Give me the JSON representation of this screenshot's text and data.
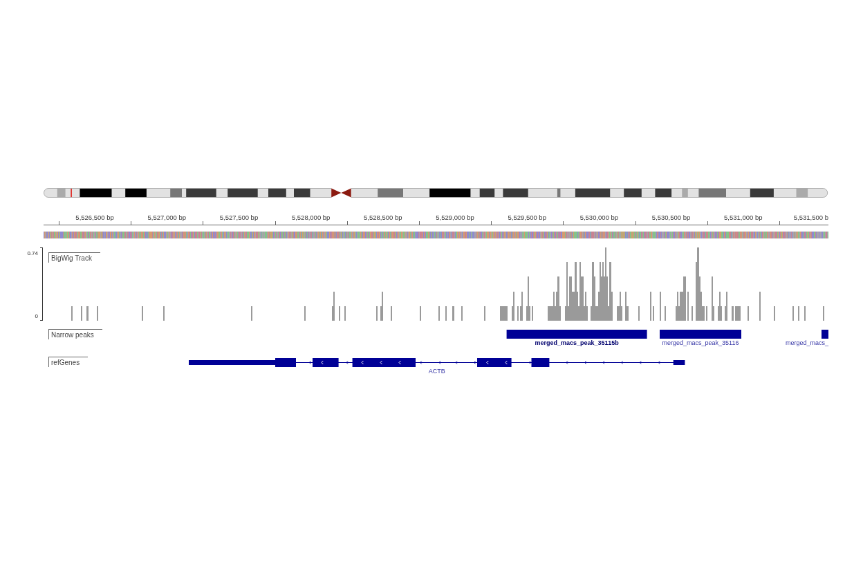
{
  "ruler": {
    "labels": [
      "5,526,500 bp",
      "5,527,000 bp",
      "5,527,500 bp",
      "5,528,000 bp",
      "5,528,500 bp",
      "5,529,000 bp",
      "5,529,500 bp",
      "5,530,000 bp",
      "5,530,500 bp",
      "5,531,000 bp",
      "5,531,500 b"
    ]
  },
  "tracks": [
    {
      "kind": "signal",
      "name": "BigWig Track",
      "scale_labels": [
        "0.74",
        "0"
      ]
    },
    {
      "kind": "peaks",
      "name": "Narrow peaks",
      "features": [
        {
          "label": "merged_macs_peak_35115b",
          "highlighted": true
        },
        {
          "label": "merged_macs_peak_35116",
          "highlighted": false
        },
        {
          "label": "merged_macs_",
          "highlighted": false
        }
      ]
    },
    {
      "kind": "genes",
      "name": "refGenes",
      "features": [
        {
          "label": "ACTB"
        }
      ]
    }
  ]
}
